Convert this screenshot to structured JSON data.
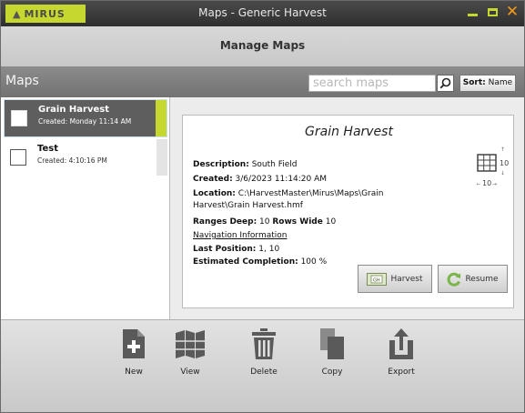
{
  "window": {
    "logo_text": "MIRUS",
    "title": "Maps - Generic Harvest"
  },
  "header": {
    "title": "Manage Maps"
  },
  "maps_bar": {
    "title": "Maps",
    "search_placeholder": "search maps",
    "sort_label": "Sort:",
    "sort_value": "Name"
  },
  "maps": [
    {
      "name": "Grain Harvest",
      "created": "Created: Monday 11:14 AM",
      "selected": true
    },
    {
      "name": "Test",
      "created": "Created: 4:10:16 PM",
      "selected": false
    }
  ],
  "details": {
    "title": "Grain Harvest",
    "description_label": "Description:",
    "description_value": "South Field",
    "created_label": "Created:",
    "created_value": "3/6/2023 11:14:20 AM",
    "location_label": "Location:",
    "location_value": "C:\\HarvestMaster\\Mirus\\Maps\\Grain Harvest\\Grain Harvest.hmf",
    "ranges_label": "Ranges Deep:",
    "ranges_value": "10",
    "rows_label": "Rows Wide",
    "rows_value": "10",
    "nav_label": "Navigation Information",
    "last_position_label": "Last Position:",
    "last_position_value": "1, 10",
    "completion_label": "Estimated Completion:",
    "completion_value": "100 %",
    "grid_rows": "10",
    "grid_cols": "10",
    "harvest_button": "Harvest",
    "resume_button": "Resume"
  },
  "toolbar": {
    "new_label": "New",
    "view_label": "View",
    "delete_label": "Delete",
    "copy_label": "Copy",
    "export_label": "Export"
  },
  "colors": {
    "accent": "#c6d82f",
    "close": "#f39a1b",
    "resume_green": "#7ab648",
    "icon_dark": "#5a5a5a"
  }
}
